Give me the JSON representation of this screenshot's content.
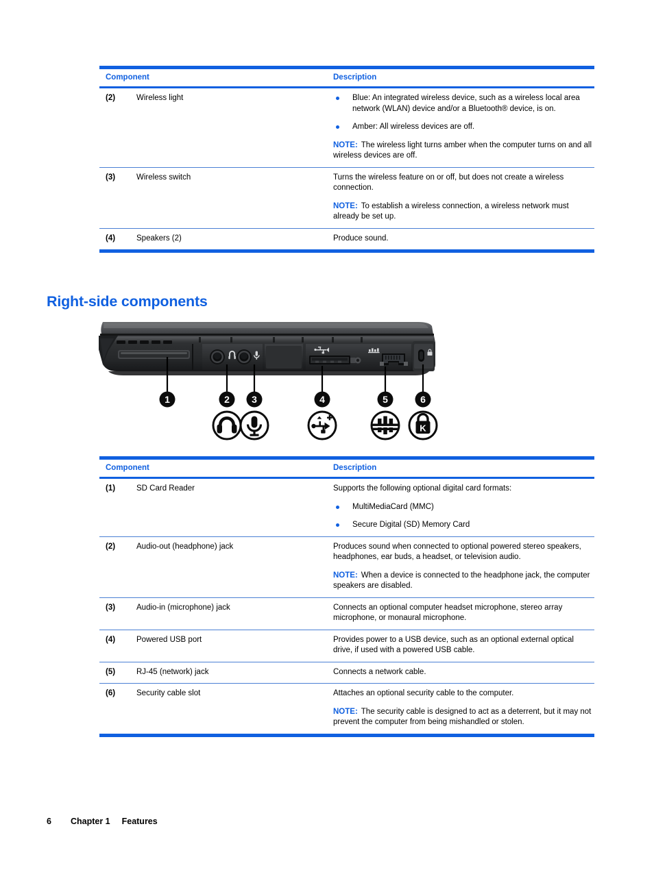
{
  "colors": {
    "accent_blue": "#1060e0",
    "rule_blue": "#4a7fd4",
    "text_black": "#000000"
  },
  "table_top": {
    "headers": {
      "component": "Component",
      "description": "Description"
    },
    "rows": [
      {
        "num": "(2)",
        "name": "Wireless light",
        "desc_type": "bullets",
        "bullets": [
          "Blue: An integrated wireless device, such as a wireless local area network (WLAN) device and/or a Bluetooth® device, is on.",
          "Amber: All wireless devices are off."
        ],
        "note_label": "NOTE:",
        "note_text": "The wireless light turns amber when the computer turns on and all wireless devices are off."
      },
      {
        "num": "(3)",
        "name": "Wireless switch",
        "desc_type": "paragraph",
        "desc": "Turns the wireless feature on or off, but does not create a wireless connection.",
        "note_label": "NOTE:",
        "note_text": "To establish a wireless connection, a wireless network must already be set up."
      },
      {
        "num": "(4)",
        "name": "Speakers (2)",
        "desc_type": "paragraph",
        "desc": "Produce sound."
      }
    ]
  },
  "heading": "Right-side components",
  "figure": {
    "alt": "Right side view of notebook computer showing ports",
    "callouts": [
      {
        "num": "1",
        "icon": null,
        "label": "SD Card Reader slot"
      },
      {
        "num": "2",
        "icon": "headphone-icon",
        "label": "Audio-out (headphone) jack"
      },
      {
        "num": "3",
        "icon": "microphone-icon",
        "label": "Audio-in (microphone) jack"
      },
      {
        "num": "4",
        "icon": "usb-power-icon",
        "label": "Powered USB port"
      },
      {
        "num": "5",
        "icon": "network-icon",
        "label": "RJ-45 (network) jack"
      },
      {
        "num": "6",
        "icon": "lock-icon",
        "label": "Security cable slot"
      }
    ]
  },
  "table_bottom": {
    "headers": {
      "component": "Component",
      "description": "Description"
    },
    "rows": [
      {
        "num": "(1)",
        "name": "SD Card Reader",
        "desc_type": "intro_bullets",
        "desc": "Supports the following optional digital card formats:",
        "bullets": [
          "MultiMediaCard (MMC)",
          "Secure Digital (SD) Memory Card"
        ]
      },
      {
        "num": "(2)",
        "name": "Audio-out (headphone) jack",
        "desc_type": "paragraph",
        "desc": "Produces sound when connected to optional powered stereo speakers, headphones, ear buds, a headset, or television audio.",
        "note_label": "NOTE:",
        "note_text": "When a device is connected to the headphone jack, the computer speakers are disabled."
      },
      {
        "num": "(3)",
        "name": "Audio-in (microphone) jack",
        "desc_type": "paragraph",
        "desc": "Connects an optional computer headset microphone, stereo array microphone, or monaural microphone."
      },
      {
        "num": "(4)",
        "name": "Powered USB port",
        "desc_type": "paragraph",
        "desc": "Provides power to a USB device, such as an optional external optical drive, if used with a powered USB cable."
      },
      {
        "num": "(5)",
        "name": "RJ-45 (network) jack",
        "desc_type": "paragraph",
        "desc": "Connects a network cable."
      },
      {
        "num": "(6)",
        "name": "Security cable slot",
        "desc_type": "paragraph",
        "desc": "Attaches an optional security cable to the computer.",
        "note_label": "NOTE:",
        "note_text": "The security cable is designed to act as a deterrent, but it may not prevent the computer from being mishandled or stolen."
      }
    ]
  },
  "footer": {
    "page_number": "6",
    "chapter": "Chapter 1",
    "chapter_title": "Features"
  }
}
